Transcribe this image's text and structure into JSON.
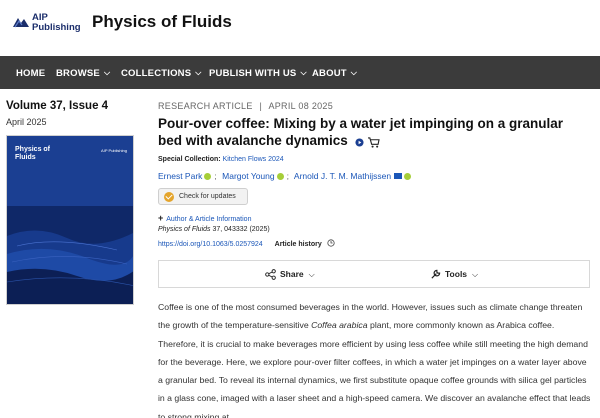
{
  "header": {
    "publisher_logo_line1": "AIP",
    "publisher_logo_line2": "Publishing",
    "journal_title": "Physics of Fluids"
  },
  "nav": {
    "items": [
      {
        "label": "HOME"
      },
      {
        "label": "BROWSE"
      },
      {
        "label": "COLLECTIONS"
      },
      {
        "label": "PUBLISH WITH US"
      },
      {
        "label": "ABOUT"
      }
    ]
  },
  "issue": {
    "volume_issue": "Volume 37, Issue 4",
    "date": "April 2025",
    "cover_title": "Physics of Fluids",
    "cover_logo": "AIP Publishing"
  },
  "article": {
    "type": "RESEARCH ARTICLE",
    "separator": "|",
    "date": "APRIL 08 2025",
    "title": "Pour-over coffee: Mixing by a water jet impinging on a granular bed with avalanche dynamics",
    "special_collection_label": "Special Collection:",
    "special_collection_name": "Kitchen Flows 2024",
    "authors": [
      "Ernest Park",
      "Margot Young",
      "Arnold J. T. M. Mathijssen"
    ],
    "author_separator": ";",
    "check_updates": "Check for updates",
    "author_info_plus": "+",
    "author_info": "Author & Article Information",
    "citation_journal": "Physics of Fluids",
    "citation_rest": " 37, 043332 (2025)",
    "doi": "https://doi.org/10.1063/5.0257924",
    "article_history": "Article history"
  },
  "toolbar": {
    "share_label": "Share",
    "tools_label": "Tools"
  },
  "abstract": {
    "part1": "Coffee is one of the most consumed beverages in the world. However, issues such as climate change threaten the growth of the temperature-sensitive ",
    "italic": "Coffea arabica",
    "part2": " plant, more commonly known as Arabica coffee. Therefore, it is crucial to make beverages more efficient by using less coffee while still meeting the high demand for the beverage. Here, we explore pour-over filter coffees, in which a water jet impinges on a water layer above a granular bed. To reveal its internal dynamics, we first substitute opaque coffee grounds with silica gel particles in a glass cone, imaged with a laser sheet and a high-speed camera. We discover an avalanche effect that leads to strong mixing at"
  },
  "colors": {
    "nav_bg": "#3b3b3b",
    "link": "#1a56b8",
    "orcid": "#a6ce39",
    "cover": "#12307a",
    "check_icon": "#e4a42b"
  }
}
